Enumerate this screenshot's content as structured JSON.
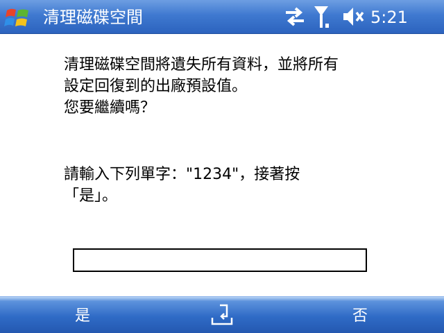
{
  "title_bar": {
    "title": "清理磁碟空間",
    "time": "5:21",
    "icons": [
      "windows-flag-icon",
      "connectivity-arrows-icon",
      "signal-antenna-icon",
      "volume-muted-icon"
    ]
  },
  "dialog": {
    "message_lines": [
      "清理磁碟空間將遺失所有資料，並將所有",
      "設定回復到的出廠預設值。",
      "您要繼續嗎？"
    ],
    "instruction_lines": [
      "請輸入下列單字：\"1234\"，接著按",
      "「是」。"
    ],
    "input_value": ""
  },
  "softkeys": {
    "left_label": "是",
    "right_label": "否",
    "center_icon": "keyboard-sip-icon"
  },
  "colors": {
    "bar_blue": "#2c63be",
    "bar_light": "#6d9ee2",
    "text": "#000000",
    "background": "#ffffff"
  }
}
